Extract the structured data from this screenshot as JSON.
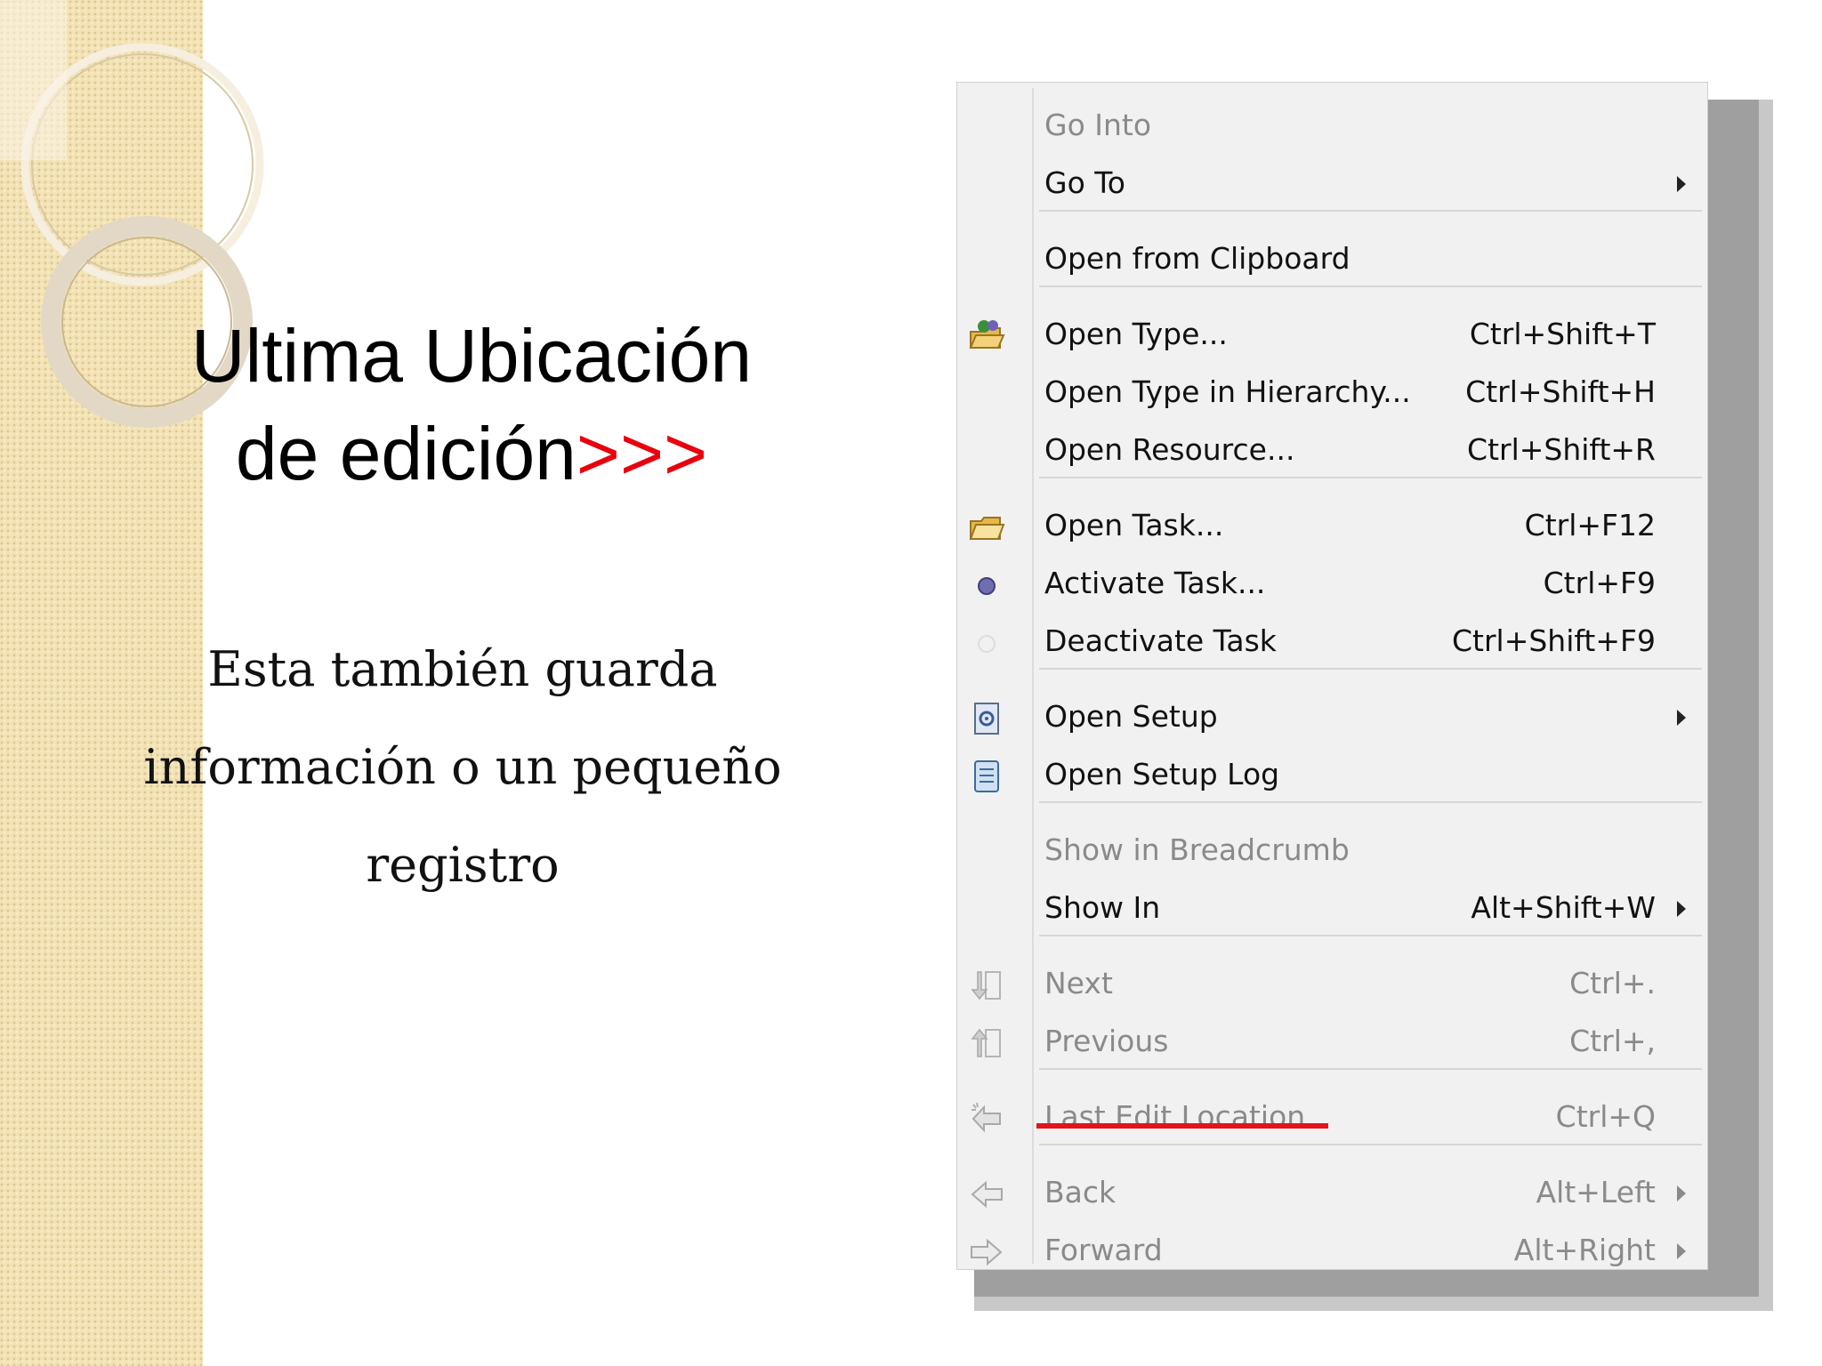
{
  "slide": {
    "title_line1": "Ultima Ubicación",
    "title_line2_text": "de edición",
    "title_line2_accent": ">>>",
    "accent_color": "#e8000c",
    "body_line1": "Esta también guarda",
    "body_line2": "información o un pequeño",
    "body_line3": "registro"
  },
  "menu": {
    "items": [
      {
        "label": "Go Into",
        "shortcut": "",
        "disabled": true,
        "submenu": false,
        "icon": ""
      },
      {
        "label": "Go To",
        "shortcut": "",
        "disabled": false,
        "submenu": true,
        "icon": ""
      },
      {
        "label": "Open from Clipboard",
        "shortcut": "",
        "disabled": false,
        "submenu": false,
        "icon": ""
      },
      {
        "label": "Open Type...",
        "shortcut": "Ctrl+Shift+T",
        "disabled": false,
        "submenu": false,
        "icon": "open-type-icon"
      },
      {
        "label": "Open Type in Hierarchy...",
        "shortcut": "Ctrl+Shift+H",
        "disabled": false,
        "submenu": false,
        "icon": ""
      },
      {
        "label": "Open Resource...",
        "shortcut": "Ctrl+Shift+R",
        "disabled": false,
        "submenu": false,
        "icon": ""
      },
      {
        "label": "Open Task...",
        "shortcut": "Ctrl+F12",
        "disabled": false,
        "submenu": false,
        "icon": "open-task-icon"
      },
      {
        "label": "Activate Task...",
        "shortcut": "Ctrl+F9",
        "disabled": false,
        "submenu": false,
        "icon": "activate-task-icon"
      },
      {
        "label": "Deactivate Task",
        "shortcut": "Ctrl+Shift+F9",
        "disabled": false,
        "submenu": false,
        "icon": "deactivate-task-icon"
      },
      {
        "label": "Open Setup",
        "shortcut": "",
        "disabled": false,
        "submenu": true,
        "icon": "open-setup-icon"
      },
      {
        "label": "Open Setup Log",
        "shortcut": "",
        "disabled": false,
        "submenu": false,
        "icon": "setup-log-icon"
      },
      {
        "label": "Show in Breadcrumb",
        "shortcut": "",
        "disabled": true,
        "submenu": false,
        "icon": ""
      },
      {
        "label": "Show In",
        "shortcut": "Alt+Shift+W",
        "disabled": false,
        "submenu": true,
        "icon": ""
      },
      {
        "label": "Next",
        "shortcut": "Ctrl+.",
        "disabled": true,
        "submenu": false,
        "icon": "next-annotation-icon"
      },
      {
        "label": "Previous",
        "shortcut": "Ctrl+,",
        "disabled": true,
        "submenu": false,
        "icon": "previous-annotation-icon"
      },
      {
        "label": "Last Edit Location",
        "shortcut": "Ctrl+Q",
        "disabled": true,
        "submenu": false,
        "icon": "last-edit-location-icon"
      },
      {
        "label": "Back",
        "shortcut": "Alt+Left",
        "disabled": true,
        "submenu": true,
        "icon": "back-arrow-icon"
      },
      {
        "label": "Forward",
        "shortcut": "Alt+Right",
        "disabled": true,
        "submenu": true,
        "icon": "forward-arrow-icon"
      }
    ],
    "highlight_color": "#e3141b"
  }
}
